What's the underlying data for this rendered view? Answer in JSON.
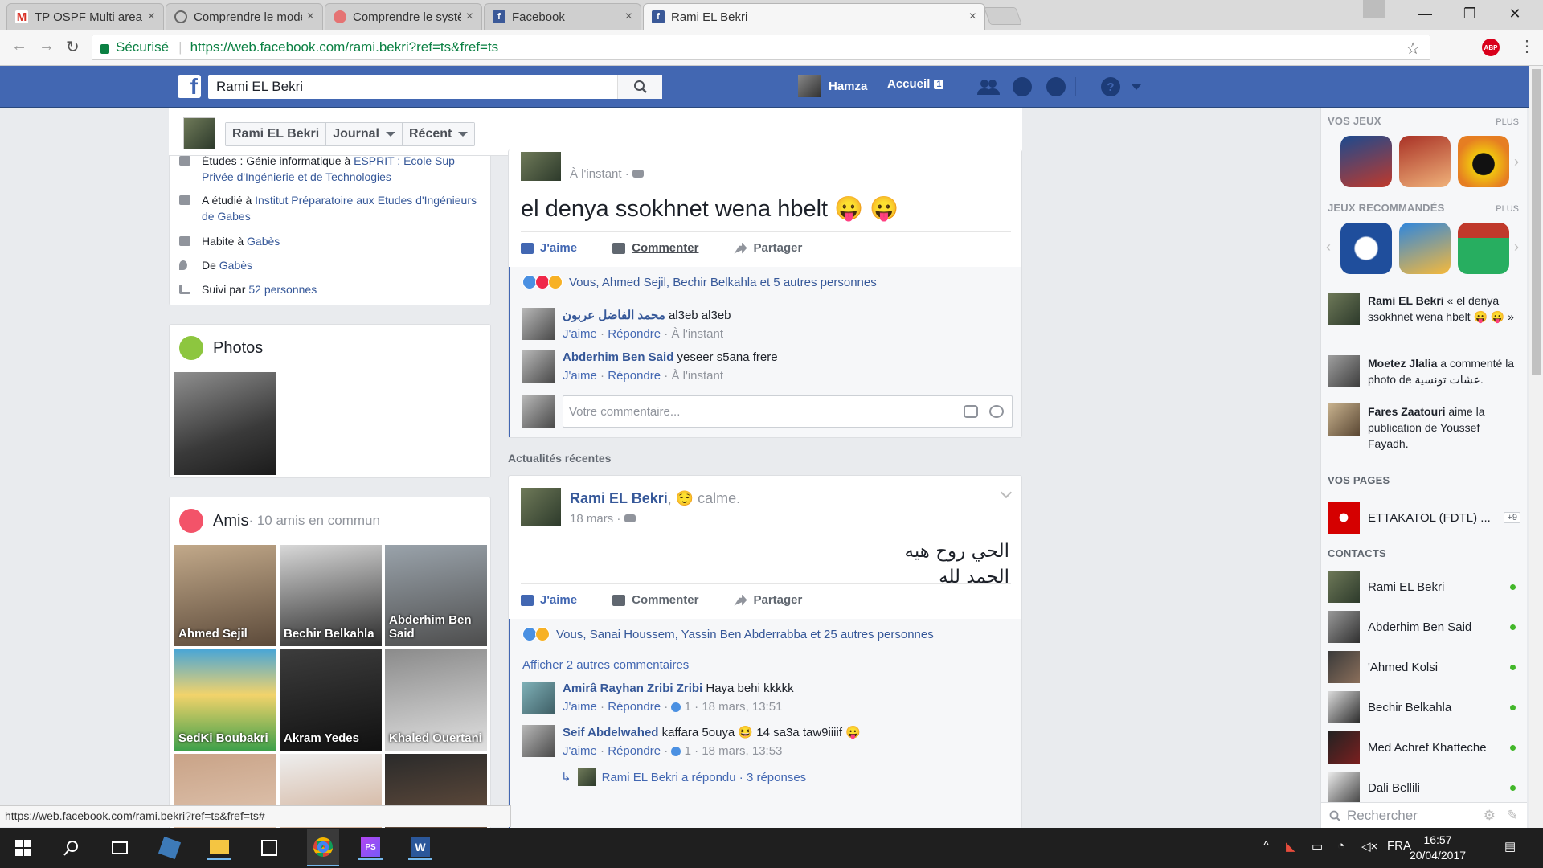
{
  "browser": {
    "tabs": [
      {
        "title": "TP OSPF Multi area - har",
        "icon": "gmail-icon",
        "color": "#d93025"
      },
      {
        "title": "Comprendre le modèle M",
        "icon": "globe-icon",
        "color": "#666666"
      },
      {
        "title": "Comprendre le système",
        "icon": "site-icon",
        "color": "#c0392b"
      },
      {
        "title": "Facebook",
        "icon": "facebook-icon",
        "color": "#3b5998"
      },
      {
        "title": "Rami EL Bekri",
        "icon": "facebook-icon",
        "color": "#3b5998"
      }
    ],
    "secure_label": "Sécurisé",
    "url": "https://web.facebook.com/rami.bekri?ref=ts&fref=ts",
    "abp_label": "ABP",
    "status_url": "https://web.facebook.com/rami.bekri?ref=ts&fref=ts#"
  },
  "header": {
    "search_value": "Rami EL Bekri",
    "user_name": "Hamza",
    "home_label": "Accueil",
    "home_count": "1"
  },
  "profile_bar": {
    "name": "Rami EL Bekri",
    "journal": "Journal",
    "recent": "Récent"
  },
  "intro": {
    "study1_prefix": "Études : Génie informatique à ",
    "study1_link": "ESPRIT : École Sup Privée d'Ingénierie et de Technologies",
    "study2_prefix": "A étudié à ",
    "study2_link": "Institut Préparatoire aux Etudes d'Ingénieurs de Gabes",
    "lives_prefix": "Habite à ",
    "lives_link": "Gabès",
    "from_prefix": "De ",
    "from_link": "Gabès",
    "followers_prefix": "Suivi par ",
    "followers_link": "52 personnes"
  },
  "photos": {
    "title": "Photos"
  },
  "friends": {
    "title": "Amis",
    "subtitle": " · 10 amis en commun",
    "items": [
      {
        "name": "Ahmed Sejil"
      },
      {
        "name": "Bechir Belkahla"
      },
      {
        "name": "Abderhim Ben Said"
      },
      {
        "name": "SedKi Boubakri"
      },
      {
        "name": "Akram Yedes"
      },
      {
        "name": "Khaled Ouertani"
      },
      {
        "name": ""
      },
      {
        "name": ""
      },
      {
        "name": ""
      }
    ]
  },
  "post1": {
    "author": "Rami EL Bekri",
    "time": "À l'instant",
    "text": "el denya ssokhnet wena hbelt 😛 😛",
    "like": "J'aime",
    "comment": "Commenter",
    "share": "Partager",
    "reactions": "Vous, Ahmed Sejil, Bechir Belkahla et 5 autres personnes",
    "comments": [
      {
        "name": "محمد الفاضل عربون",
        "text": "al3eb al3eb",
        "like": "J'aime",
        "reply": "Répondre",
        "time": "À l'instant"
      },
      {
        "name": "Abderhim Ben Said",
        "text": "yeseer s5ana frere",
        "like": "J'aime",
        "reply": "Répondre",
        "time": "À l'instant"
      }
    ],
    "comment_placeholder": "Votre commentaire..."
  },
  "recent_title": "Actualités récentes",
  "post2": {
    "author": "Rami EL Bekri",
    "feeling": ", 😌 calme.",
    "time": "18 mars",
    "text_line1": "الحي روح هيه",
    "text_line2": "الحمد لله",
    "like": "J'aime",
    "comment": "Commenter",
    "share": "Partager",
    "reactions": "Vous, Sanai Houssem, Yassin Ben Abderrabba et 25 autres personnes",
    "more_comments": "Afficher 2 autres commentaires",
    "comments": [
      {
        "name": "Amirâ Rayhan Zribi Zribi",
        "text": "Haya behi kkkkk",
        "like": "J'aime",
        "reply": "Répondre",
        "likes": "1",
        "time": "18 mars, 13:51"
      },
      {
        "name": "Seif Abdelwahed",
        "text": "kaffara 5ouya 😆 14 sa3a taw9iiiif 😛",
        "like": "J'aime",
        "reply": "Répondre",
        "likes": "1",
        "time": "18 mars, 13:53"
      }
    ],
    "replied": "Rami EL Bekri a répondu",
    "replies": "3 réponses"
  },
  "sidebar": {
    "games_title": "VOS JEUX",
    "games_more": "PLUS",
    "recommended_title": "JEUX RECOMMANDÉS",
    "recommended_more": "PLUS",
    "ticker": [
      {
        "name": "Rami EL Bekri",
        "text": " « el denya ssokhnet wena hbelt 😛 😛 »"
      },
      {
        "name": "Moetez Jlalia",
        "text": " a commenté la photo de عشات تونسية."
      },
      {
        "name": "Fares Zaatouri",
        "text": " aime la publication de Youssef Fayadh."
      }
    ],
    "pages_title": "VOS PAGES",
    "page_name": "ETTAKATOL (FDTL) ...",
    "page_badge": "+9",
    "contacts_title": "CONTACTS",
    "contacts": [
      {
        "name": "Rami EL Bekri"
      },
      {
        "name": "Abderhim Ben Said"
      },
      {
        "name": "'Ahmed Kolsi"
      },
      {
        "name": "Bechir Belkahla"
      },
      {
        "name": "Med Achref Khatteche"
      },
      {
        "name": "Dali Bellili"
      }
    ],
    "search_placeholder": "Rechercher"
  },
  "taskbar": {
    "lang": "FRA",
    "time": "16:57",
    "date": "20/04/2017"
  }
}
